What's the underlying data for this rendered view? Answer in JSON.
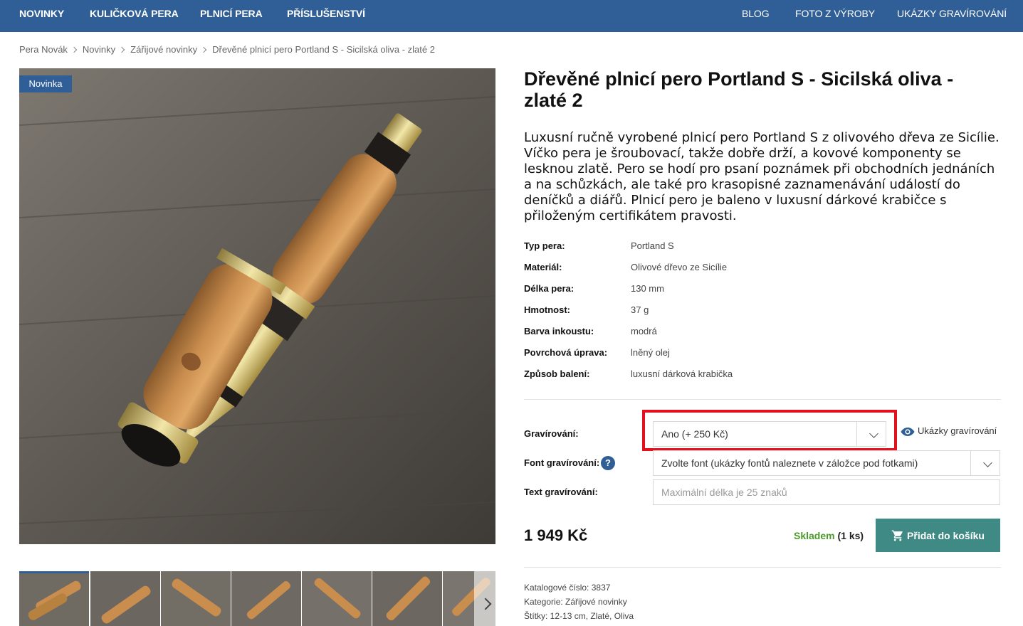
{
  "nav": {
    "left": [
      "NOVINKY",
      "KULIČKOVÁ PERA",
      "PLNICÍ PERA",
      "PŘÍSLUŠENSTVÍ"
    ],
    "right": [
      "BLOG",
      "FOTO Z VÝROBY",
      "UKÁZKY GRAVÍROVÁNÍ"
    ]
  },
  "breadcrumb": [
    "Pera Novák",
    "Novinky",
    "Zářijové novinky",
    "Dřevěné plnicí pero Portland S - Sicilská oliva - zlaté 2"
  ],
  "badge": "Novinka",
  "product": {
    "title": "Dřevěné plnicí pero Portland S - Sicilská oliva - zlaté 2",
    "description": "Luxusní ručně vyrobené plnicí pero Portland S z olivového dřeva ze Sicílie. Víčko pera je šroubovací, takže dobře drží, a kovové komponenty se lesknou zlatě. Pero se hodí pro psaní poznámek při obchodních jednáních a na schůzkách, ale také pro krasopisné zaznamenávání událostí do deníčků a diářů. Plnicí pero je baleno v luxusní dárkové krabičce s přiloženým certifikátem pravosti.",
    "specs": [
      {
        "label": "Typ pera:",
        "value": "Portland S"
      },
      {
        "label": "Materiál:",
        "value": "Olivové dřevo ze Sicílie"
      },
      {
        "label": "Délka pera:",
        "value": "130 mm"
      },
      {
        "label": "Hmotnost:",
        "value": "37 g"
      },
      {
        "label": "Barva inkoustu:",
        "value": "modrá"
      },
      {
        "label": "Povrchová úprava:",
        "value": "lněný olej"
      },
      {
        "label": "Způsob balení:",
        "value": "luxusní dárková krabička"
      }
    ],
    "price": "1 949 Kč",
    "stock": {
      "status": "Skladem",
      "count": "(1 ks)"
    },
    "cart_label": "Přidat do košíku",
    "meta": {
      "catalog": "Katalogové číslo: 3837",
      "category": "Kategorie: Zářijové novinky",
      "tags": "Štítky: 12-13 cm, Zlaté, Oliva"
    }
  },
  "options": {
    "engraving_label": "Gravírování:",
    "engraving_value": "Ano (+ 250 Kč)",
    "engraving_examples": "Ukázky gravírování",
    "font_label": "Font gravírování:",
    "font_value": "Zvolte font (ukázky fontů naleznete v záložce pod fotkami)",
    "help_glyph": "?",
    "text_label": "Text gravírování:",
    "text_placeholder": "Maximální délka je 25 znaků"
  },
  "icons": {
    "eye": "eye-icon",
    "cart": "cart-icon",
    "help": "help-icon",
    "next": "chevron-right-icon"
  },
  "colors": {
    "nav": "#2f5f96",
    "cart_button": "#3f8a84",
    "stock": "#4c9a2a",
    "highlight": "#e3101e"
  }
}
